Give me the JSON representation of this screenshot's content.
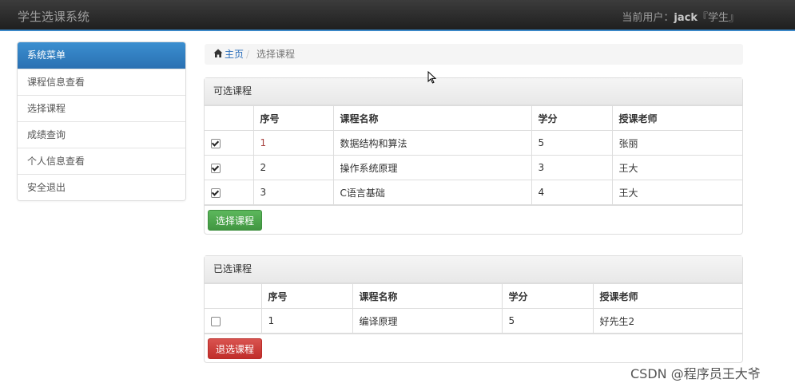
{
  "navbar": {
    "brand": "学生选课系统",
    "user_prefix": "当前用户：",
    "user_name": "jack",
    "user_role": "『学生』"
  },
  "sidebar": {
    "header": "系统菜单",
    "items": [
      {
        "label": "课程信息查看"
      },
      {
        "label": "选择课程"
      },
      {
        "label": "成绩查询"
      },
      {
        "label": "个人信息查看"
      },
      {
        "label": "安全退出"
      }
    ]
  },
  "breadcrumb": {
    "home": "主页",
    "current": "选择课程"
  },
  "available": {
    "title": "可选课程",
    "headers": [
      "",
      "序号",
      "课程名称",
      "学分",
      "授课老师"
    ],
    "rows": [
      {
        "checked": true,
        "num": "1",
        "name": "数据结构和算法",
        "credit": "5",
        "teacher": "张丽"
      },
      {
        "checked": true,
        "num": "2",
        "name": "操作系统原理",
        "credit": "3",
        "teacher": "王大"
      },
      {
        "checked": true,
        "num": "3",
        "name": "C语言基础",
        "credit": "4",
        "teacher": "王大"
      }
    ],
    "button": "选择课程"
  },
  "selected": {
    "title": "已选课程",
    "headers": [
      "",
      "序号",
      "课程名称",
      "学分",
      "授课老师"
    ],
    "rows": [
      {
        "checked": false,
        "num": "1",
        "name": "编译原理",
        "credit": "5",
        "teacher": "好先生2"
      }
    ],
    "button": "退选课程"
  },
  "watermark": "CSDN @程序员王大爷"
}
